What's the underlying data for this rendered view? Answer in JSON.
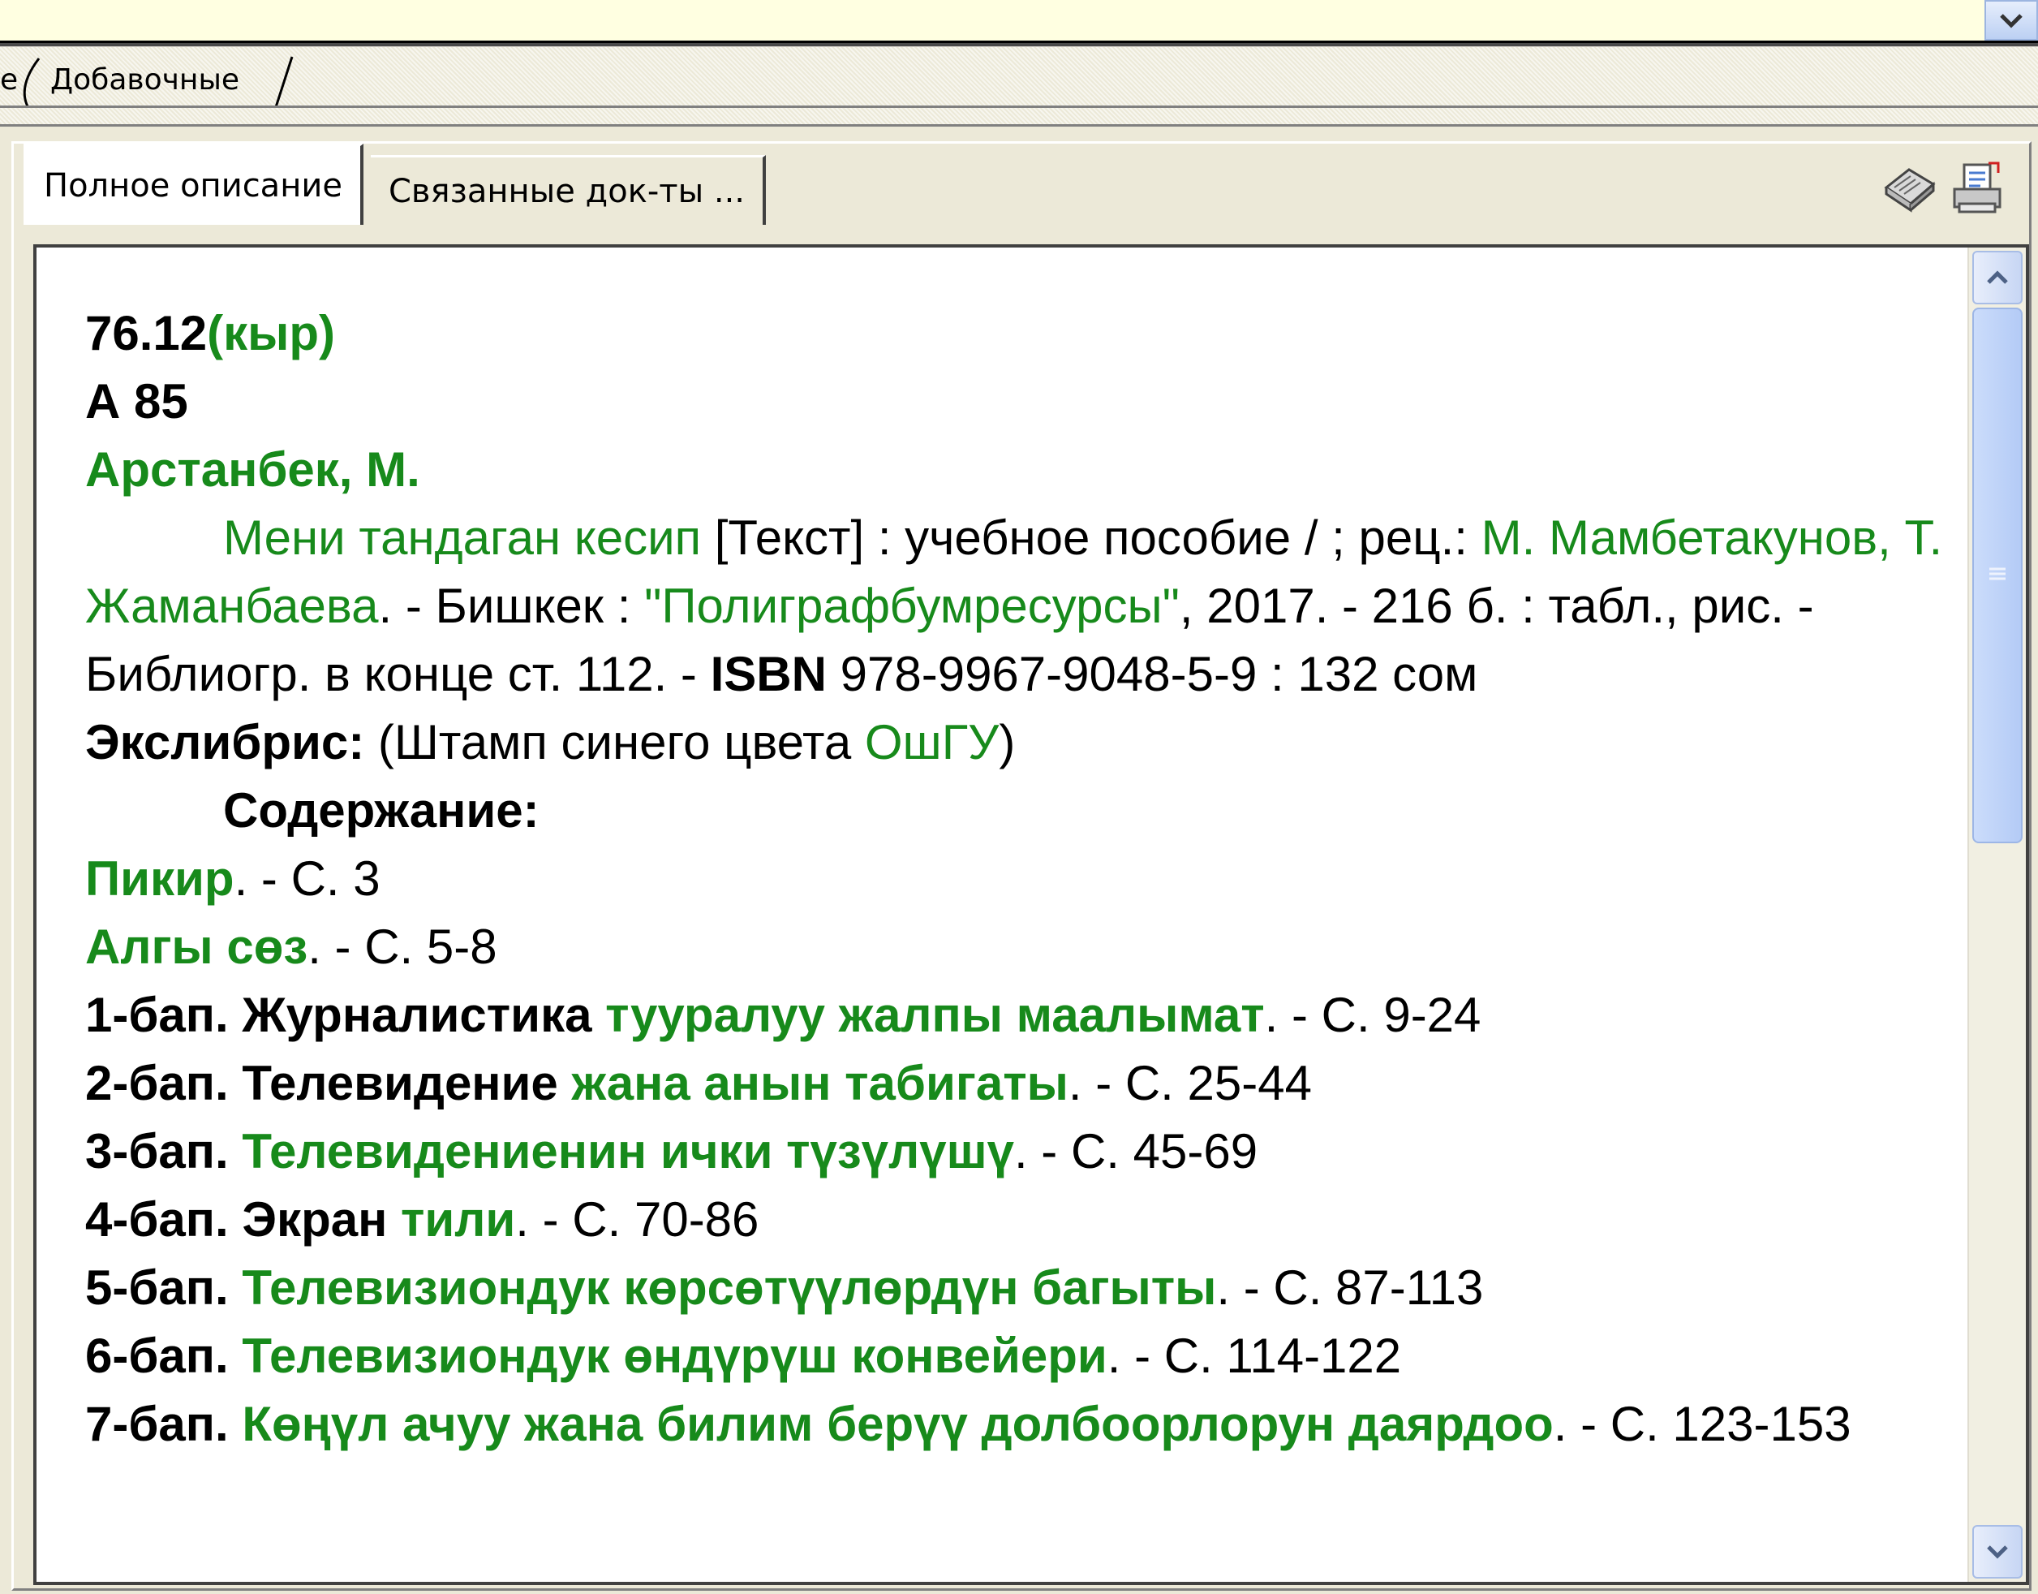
{
  "upper_tabs": {
    "partial": "е",
    "additional": "Добавочные"
  },
  "tabs": {
    "full_description": "Полное описание",
    "related_docs": "Связанные док-ты ..."
  },
  "record": {
    "class_code": "76.12",
    "class_lang": "(кыр)",
    "author_mark": "А 85",
    "author": "Арстанбек, М.",
    "title_green": "Мени тандаган кесип",
    "title_rest": " [Текст] : учебное пособие / ; рец.: ",
    "reviewers": "М. Мамбетакунов, Т. Жаманбаева",
    "place": ". - Бишкек : ",
    "publisher": "\"Полиграфбумресурсы\"",
    "year_pages": ", 2017. - 216 б. : табл., рис. - Библиогр. в конце ст. 112. - ",
    "isbn_label": "ISBN",
    "isbn_value": " 978-9967-9048-5-9 : 132 сом",
    "exlibris_label": "Экслибрис:",
    "exlibris_text": " (Штамп синего цвета ",
    "exlibris_org": "ОшГУ",
    "exlibris_close": ")",
    "contents_label": "Содержание:",
    "contents": [
      {
        "bold": "",
        "green": "Пикир",
        "pages": ". - С. 3"
      },
      {
        "bold": "",
        "green": "Алгы сөз",
        "pages": ". - С. 5-8"
      },
      {
        "bold": "1-бап. Журналистика ",
        "green": "тууралуу жалпы маалымат",
        "pages": ". - С. 9-24"
      },
      {
        "bold": "2-бап. Телевидение ",
        "green": "жана анын табигаты",
        "pages": ". - С. 25-44"
      },
      {
        "bold": "3-бап. ",
        "green": "Телевидениенин ички түзүлүшү",
        "pages": ". - С. 45-69"
      },
      {
        "bold": "4-бап. Экран ",
        "green": "тили",
        "pages": ". - С. 70-86"
      },
      {
        "bold": "5-бап. ",
        "green": "Телевизиондук көрсөтүүлөрдүн багыты",
        "pages": ". - С. 87-113"
      },
      {
        "bold": "6-бап. ",
        "green": "Телевизиондук өндүрүш конвейери",
        "pages": ". - С. 114-122"
      },
      {
        "bold": "7-бап. ",
        "green": "Көңүл ачуу жана билим берүү долбоорлорун даярдоо",
        "pages": ". - С. 123-153"
      }
    ]
  },
  "icons": {
    "tool1": "book-icon",
    "tool2": "print-preview-icon"
  },
  "colors": {
    "link_green": "#178a1b",
    "background": "#ece9d8",
    "tooltip_yellow": "#ffffe1"
  }
}
